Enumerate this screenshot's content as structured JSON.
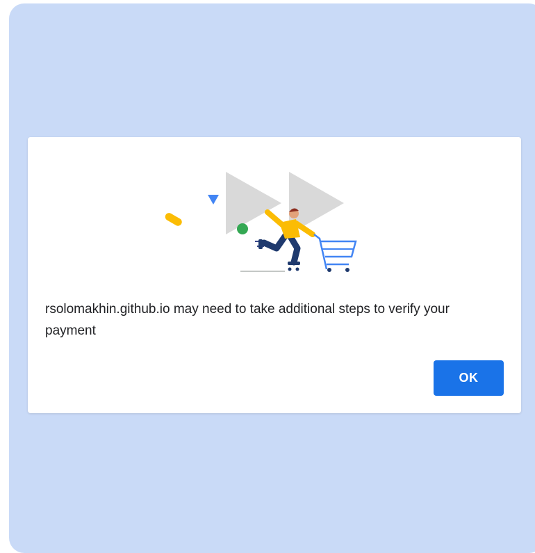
{
  "dialog": {
    "message": "rsolomakhin.github.io may need to take additional steps to verify your payment",
    "ok_label": "OK",
    "illustration_icon": "shopping-cart-illustration"
  },
  "colors": {
    "background": "#c9daf7",
    "dialog": "#ffffff",
    "accent": "#1a73e8",
    "text": "#202124"
  }
}
